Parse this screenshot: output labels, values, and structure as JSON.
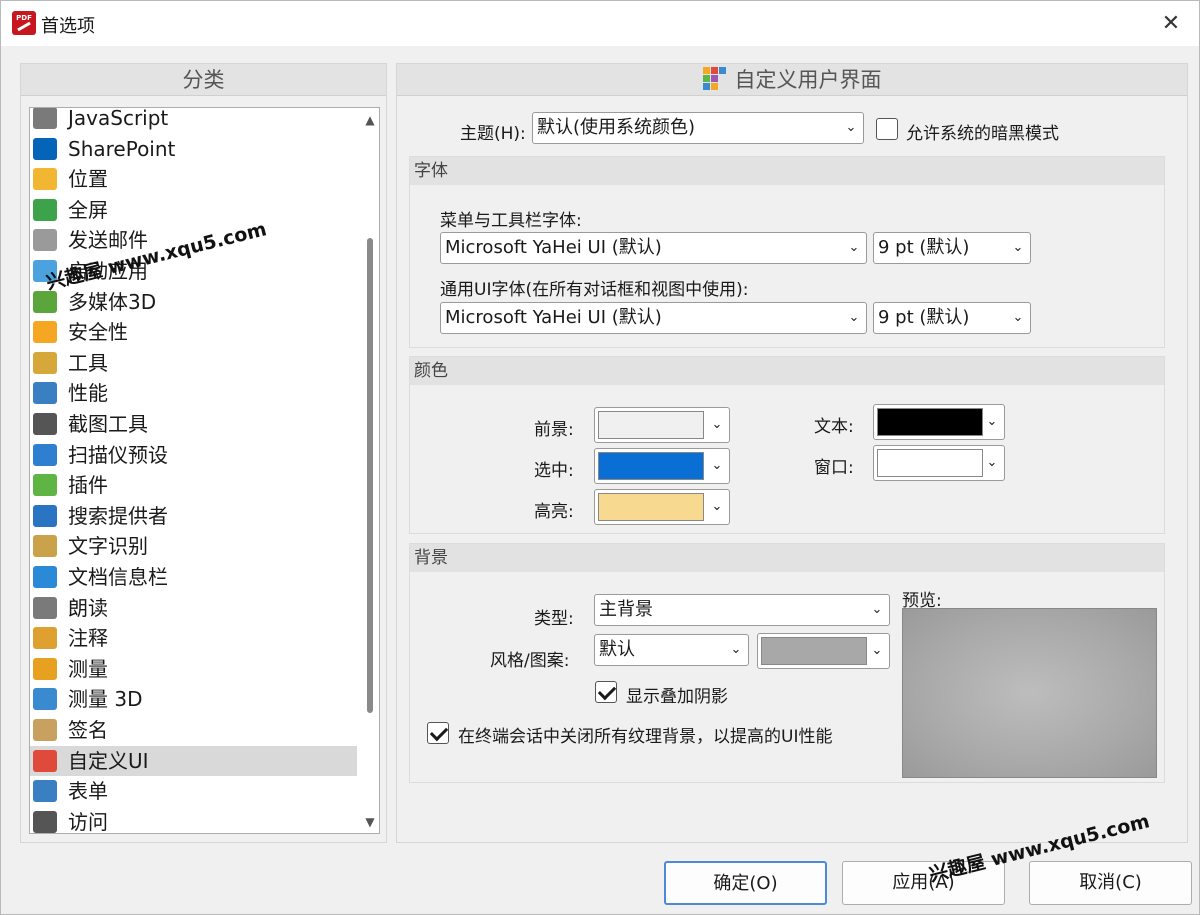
{
  "window": {
    "title": "首选项",
    "close_glyph": "✕",
    "app_icon_text": "PDF"
  },
  "left": {
    "header": "分类",
    "items": [
      {
        "label": "JavaScript",
        "icon": "javascript-gear-icon",
        "color": "#7a7a7a"
      },
      {
        "label": "SharePoint",
        "icon": "sharepoint-icon",
        "color": "#0364b8"
      },
      {
        "label": "位置",
        "icon": "folder-icon",
        "color": "#f2b632"
      },
      {
        "label": "全屏",
        "icon": "fullscreen-icon",
        "color": "#3ca34a"
      },
      {
        "label": "发送邮件",
        "icon": "email-icon",
        "color": "#9a9a9a"
      },
      {
        "label": "启动应用",
        "icon": "launch-app-icon",
        "color": "#4aa3df"
      },
      {
        "label": "多媒体3D",
        "icon": "multimedia-3d-icon",
        "color": "#5aa63a"
      },
      {
        "label": "安全性",
        "icon": "shield-icon",
        "color": "#f5a623"
      },
      {
        "label": "工具",
        "icon": "tools-icon",
        "color": "#d6a83a"
      },
      {
        "label": "性能",
        "icon": "gauge-icon",
        "color": "#3a7fc1"
      },
      {
        "label": "截图工具",
        "icon": "camera-icon",
        "color": "#555555"
      },
      {
        "label": "扫描仪预设",
        "icon": "scanner-icon",
        "color": "#2f7fd1"
      },
      {
        "label": "插件",
        "icon": "plugin-puzzle-icon",
        "color": "#5fb544"
      },
      {
        "label": "搜索提供者",
        "icon": "globe-search-icon",
        "color": "#2a74c4"
      },
      {
        "label": "文字识别",
        "icon": "ocr-document-icon",
        "color": "#c9a24a"
      },
      {
        "label": "文档信息栏",
        "icon": "info-icon",
        "color": "#2a8ad8"
      },
      {
        "label": "朗读",
        "icon": "speaker-icon",
        "color": "#7a7a7a"
      },
      {
        "label": "注释",
        "icon": "annotation-icon",
        "color": "#e0a030"
      },
      {
        "label": "测量",
        "icon": "ruler-triangle-icon",
        "color": "#e8a020"
      },
      {
        "label": "测量 3D",
        "icon": "measure-3d-icon",
        "color": "#3a8ad0"
      },
      {
        "label": "签名",
        "icon": "signature-icon",
        "color": "#c8a060"
      },
      {
        "label": "自定义UI",
        "icon": "custom-ui-icon",
        "color": "#e04a3a"
      },
      {
        "label": "表单",
        "icon": "form-icon",
        "color": "#3a7fc1"
      },
      {
        "label": "访问",
        "icon": "glasses-icon",
        "color": "#555555"
      }
    ],
    "selected_index": 21
  },
  "right": {
    "header": "自定义用户界面",
    "theme_label": "主题(H):",
    "theme_value": "默认(使用系统颜色)",
    "dark_mode_label": "允许系统的暗黑模式",
    "dark_mode_checked": false,
    "fonts": {
      "title": "字体",
      "menu_font_label": "菜单与工具栏字体:",
      "menu_font_value": "Microsoft YaHei UI (默认)",
      "menu_size_value": "9 pt (默认)",
      "ui_font_label": "通用UI字体(在所有对话框和视图中使用):",
      "ui_font_value": "Microsoft YaHei UI (默认)",
      "ui_size_value": "9 pt (默认)"
    },
    "colors": {
      "title": "颜色",
      "foreground_label": "前景:",
      "foreground_color": "#f0f0f0",
      "selection_label": "选中:",
      "selection_color": "#0a6fd4",
      "highlight_label": "高亮:",
      "highlight_color": "#f8d990",
      "text_label": "文本:",
      "text_color": "#000000",
      "window_label": "窗口:",
      "window_color": "#ffffff"
    },
    "background": {
      "title": "背景",
      "type_label": "类型:",
      "type_value": "主背景",
      "style_label": "风格/图案:",
      "style_value": "默认",
      "style_color": "#a8a8a8",
      "show_shadow_label": "显示叠加阴影",
      "show_shadow_checked": true,
      "terminal_label": "在终端会话中关闭所有纹理背景，以提高的UI性能",
      "terminal_checked": true,
      "preview_label": "预览:"
    }
  },
  "buttons": {
    "ok": "确定(O)",
    "apply": "应用(A)",
    "cancel": "取消(C)"
  },
  "watermarks": [
    "兴趣屋 www.xqu5.com",
    "兴趣屋 www.xqu5.com"
  ]
}
